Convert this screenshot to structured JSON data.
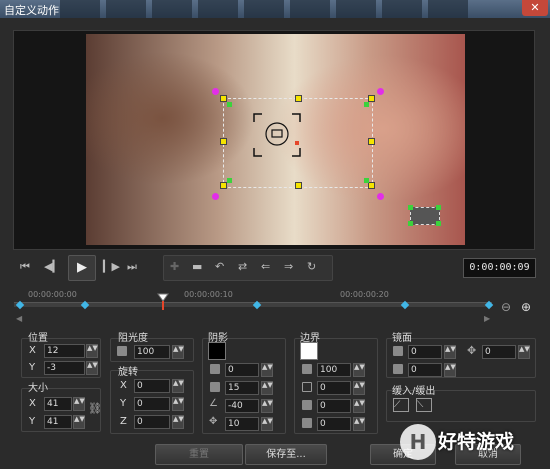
{
  "window": {
    "title": "自定义动作"
  },
  "transport": {
    "timecode": "0:00:00:09"
  },
  "timeline": {
    "ticks": [
      "00:00:00:00",
      "00:00:00:10",
      "00:00:00:20"
    ]
  },
  "position": {
    "title": "位置",
    "x_label": "X",
    "y_label": "Y",
    "x": "12",
    "y": "-3"
  },
  "size": {
    "title": "大小",
    "x_label": "X",
    "y_label": "Y",
    "x": "41",
    "y": "41"
  },
  "opacity": {
    "title": "阻光度",
    "value": "100"
  },
  "rotation": {
    "title": "旋转",
    "x_label": "X",
    "y_label": "Y",
    "z_label": "Z",
    "x": "0",
    "y": "0",
    "z": "0"
  },
  "shadow": {
    "title": "阴影",
    "color": "#000000",
    "v1": "0",
    "v2": "15",
    "v3": "-40",
    "v4": "10"
  },
  "border": {
    "title": "边界",
    "color": "#ffffff",
    "v1": "100",
    "v2": "0",
    "v3": "0",
    "v4": "0"
  },
  "mirror": {
    "title": "镜面",
    "v1": "0",
    "v2": "0",
    "v3": "0"
  },
  "fade": {
    "title": "缓入/缓出"
  },
  "buttons": {
    "reset": "重置",
    "save_to": "保存至...",
    "ok": "确定",
    "cancel": "取消"
  },
  "watermark": {
    "text": "好特游戏",
    "badge": "H"
  }
}
